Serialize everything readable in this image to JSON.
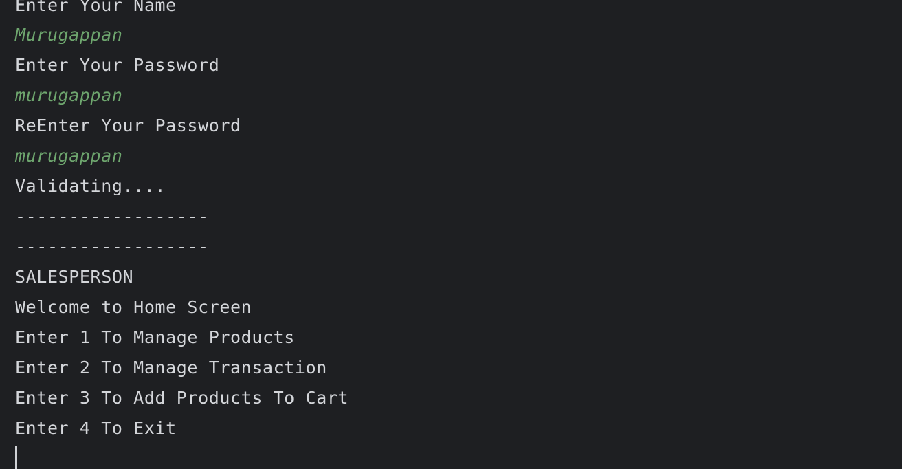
{
  "console": {
    "lines": [
      {
        "text": "Enter Your Name",
        "kind": "output"
      },
      {
        "text": "Murugappan",
        "kind": "input"
      },
      {
        "text": "Enter Your Password",
        "kind": "output"
      },
      {
        "text": "murugappan",
        "kind": "input"
      },
      {
        "text": "ReEnter Your Password",
        "kind": "output"
      },
      {
        "text": "murugappan",
        "kind": "input"
      },
      {
        "text": "Validating....",
        "kind": "output"
      },
      {
        "text": "------------------",
        "kind": "output"
      },
      {
        "text": "------------------",
        "kind": "output"
      },
      {
        "text": "SALESPERSON",
        "kind": "output"
      },
      {
        "text": "Welcome to Home Screen",
        "kind": "output"
      },
      {
        "text": "Enter 1 To Manage Products",
        "kind": "output"
      },
      {
        "text": "Enter 2 To Manage Transaction",
        "kind": "output"
      },
      {
        "text": "Enter 3 To Add Products To Cart",
        "kind": "output"
      },
      {
        "text": "Enter 4 To Exit",
        "kind": "output"
      }
    ]
  },
  "colors": {
    "background": "#1e1f22",
    "output_text": "#d4d6da",
    "input_text": "#6ea66e"
  }
}
